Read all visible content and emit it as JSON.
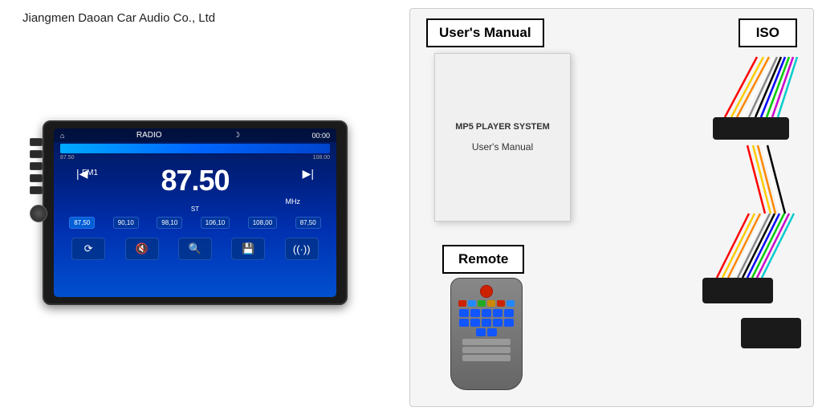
{
  "header": {
    "company": "Jiangmen Daoan Car Audio Co., Ltd"
  },
  "radio": {
    "mode": "RADIO",
    "time": "00:00",
    "freq_low": "87.50",
    "freq_high": "108.00",
    "fm_label": "FM1",
    "frequency": "87.50",
    "unit": "MHz",
    "st": "ST",
    "presets": [
      "87,50",
      "90,10",
      "98,10",
      "106,10",
      "108,00",
      "87,50"
    ],
    "icons": [
      "⟳",
      "🔇",
      "🔍",
      "💾",
      "((·))"
    ]
  },
  "accessories": {
    "manual_label": "User's Manual",
    "iso_label": "ISO",
    "remote_label": "Remote",
    "book": {
      "title": "MP5 PLAYER SYSTEM",
      "subtitle": "User's Manual"
    }
  }
}
